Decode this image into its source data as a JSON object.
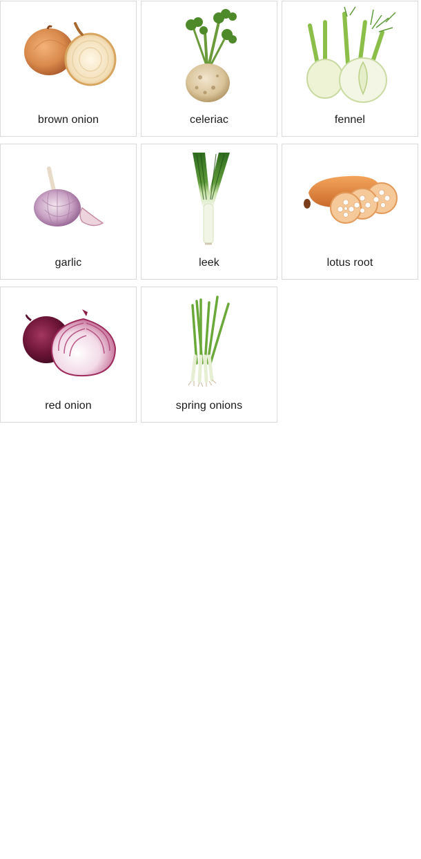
{
  "cards": [
    {
      "label": "brown onion",
      "icon": "brown-onion-image"
    },
    {
      "label": "celeriac",
      "icon": "celeriac-image"
    },
    {
      "label": "fennel",
      "icon": "fennel-image"
    },
    {
      "label": "garlic",
      "icon": "garlic-image"
    },
    {
      "label": "leek",
      "icon": "leek-image"
    },
    {
      "label": "lotus root",
      "icon": "lotus-root-image"
    },
    {
      "label": "red onion",
      "icon": "red-onion-image"
    },
    {
      "label": "spring onions",
      "icon": "spring-onions-image"
    }
  ]
}
